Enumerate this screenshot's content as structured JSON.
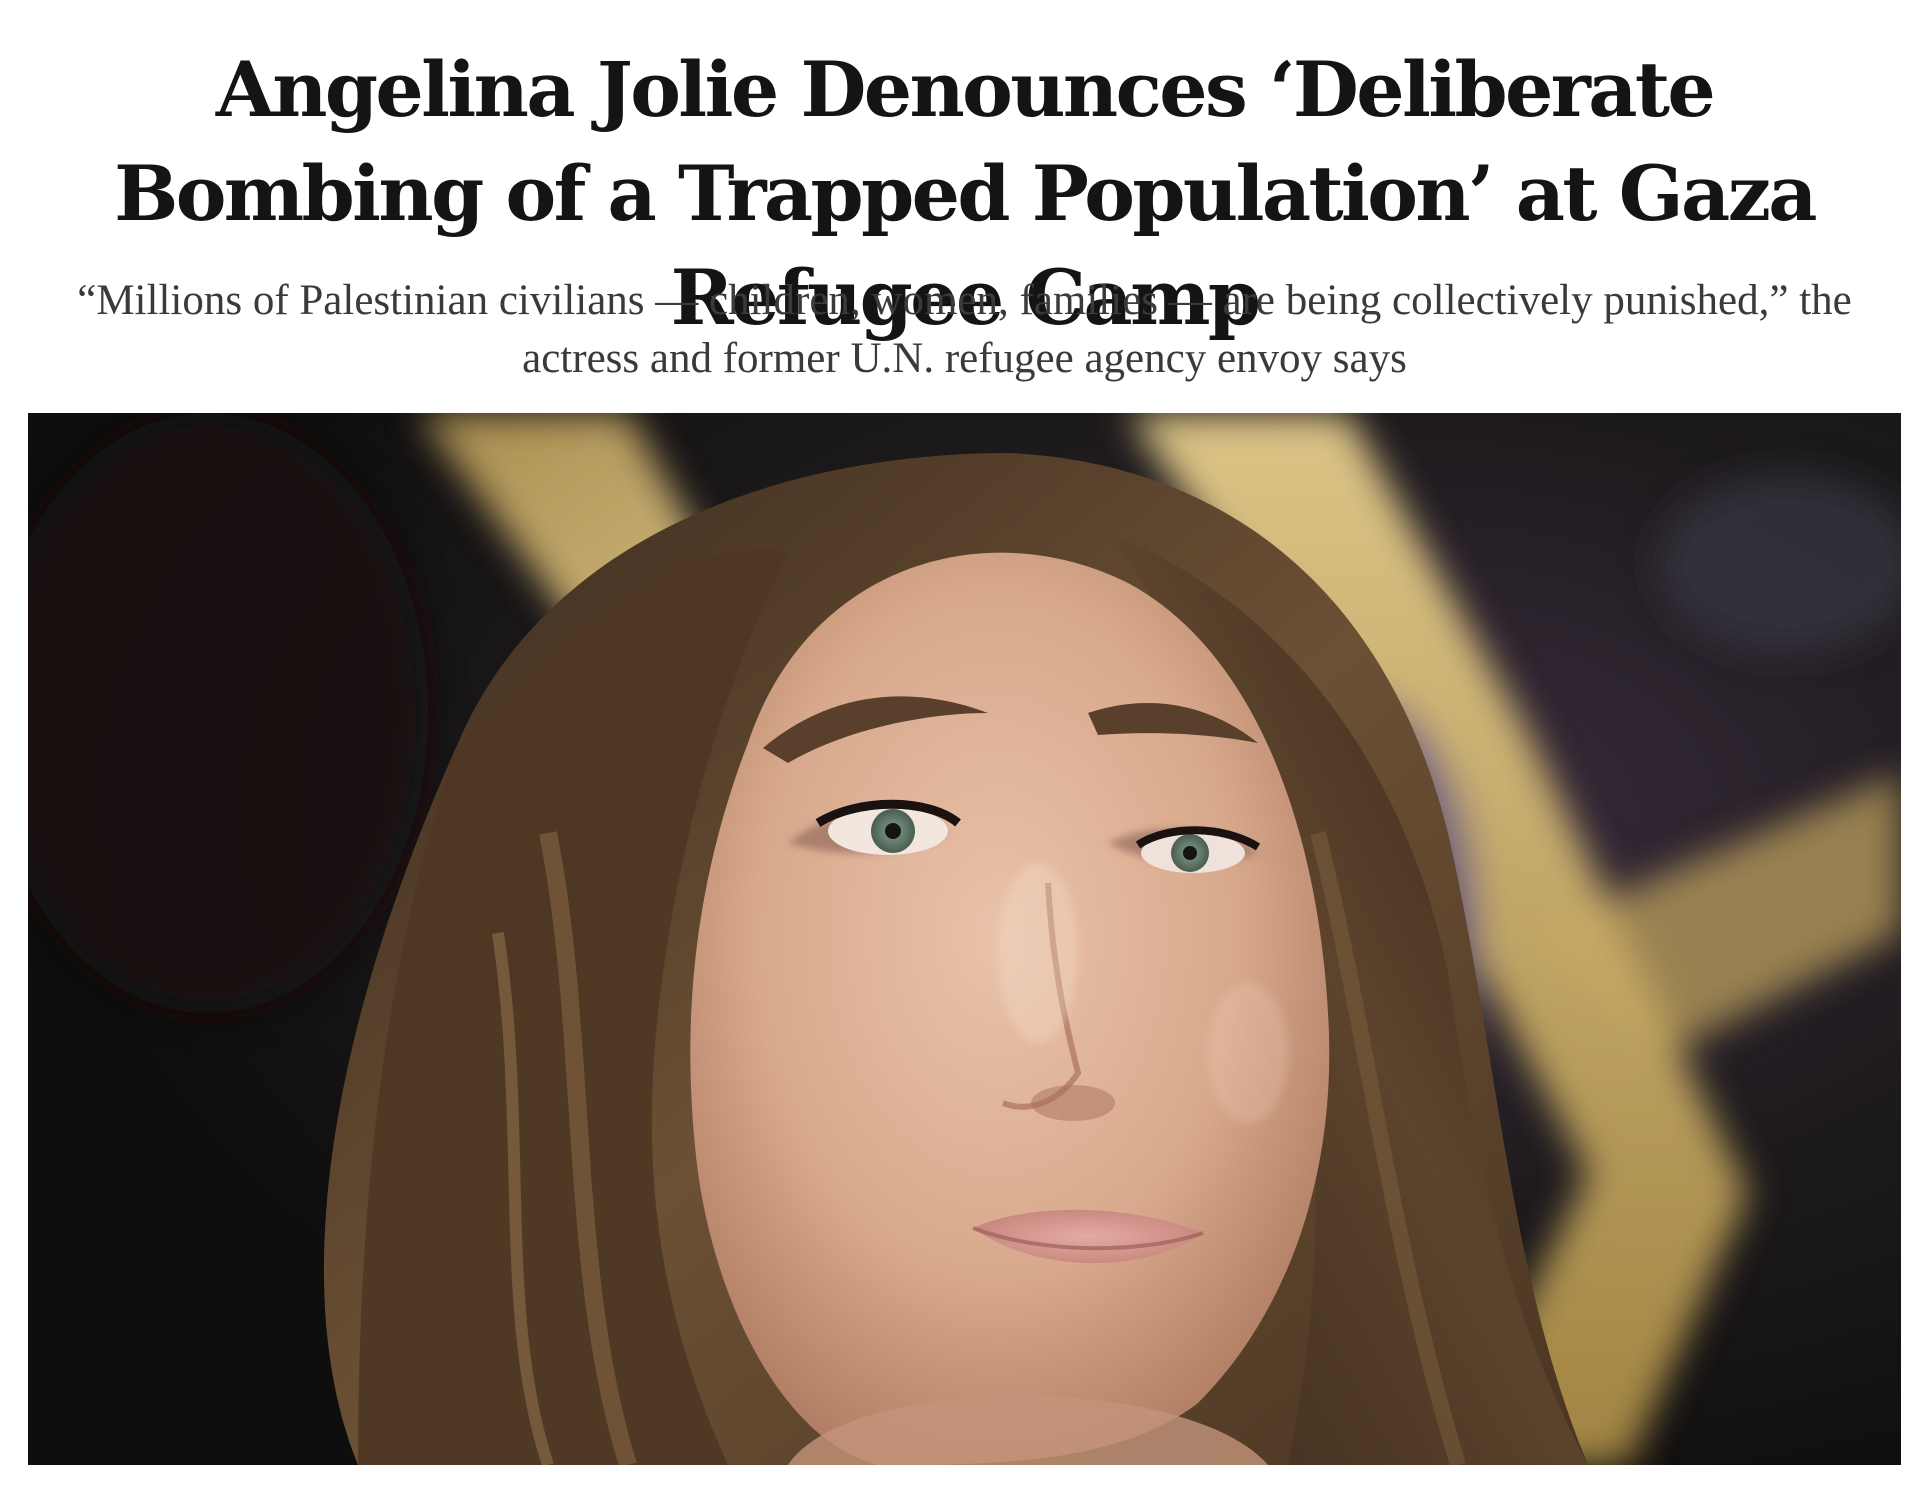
{
  "article": {
    "headline": "Angelina Jolie Denounces ‘Deliberate Bombing of a Trapped Population’ at Gaza Refugee Camp",
    "dek": "“Millions of Palestinian civilians — children, women, families — are being collectively punished,” the actress and former U.N. refugee agency envoy says"
  },
  "hero_image": {
    "subject": "close-up portrait photo of a woman with long brown hair against a dark background with blurred gold shapes"
  }
}
